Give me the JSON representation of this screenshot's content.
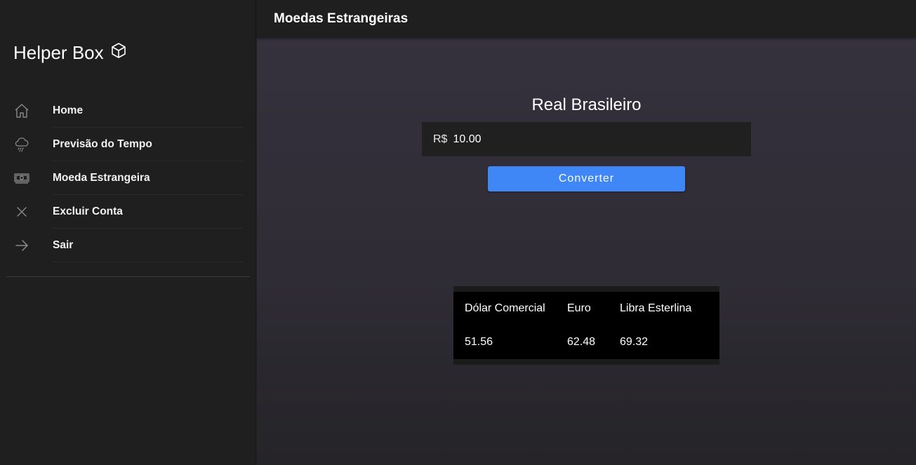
{
  "sidebar": {
    "brand": "Helper Box",
    "brand_icon": "cube-icon",
    "items": [
      {
        "label": "Home",
        "icon": "home-icon"
      },
      {
        "label": "Previsão do Tempo",
        "icon": "rain-cloud-icon"
      },
      {
        "label": "Moeda Estrangeira",
        "icon": "banknote-icon"
      },
      {
        "label": "Excluir Conta",
        "icon": "close-icon"
      },
      {
        "label": "Sair",
        "icon": "arrow-right-icon"
      }
    ]
  },
  "header": {
    "title": "Moedas Estrangeiras"
  },
  "converter": {
    "title": "Real Brasileiro",
    "prefix": "R$",
    "value": "10.00",
    "button_label": "Converter"
  },
  "rates": {
    "columns": [
      "Dólar Comercial",
      "Euro",
      "Libra Esterlina"
    ],
    "values": [
      "51.56",
      "62.48",
      "69.32"
    ]
  },
  "colors": {
    "accent": "#3f86f7",
    "sidebar_bg": "#1f1f1f",
    "main_bg": "#35313d",
    "table_bg": "#000000"
  }
}
